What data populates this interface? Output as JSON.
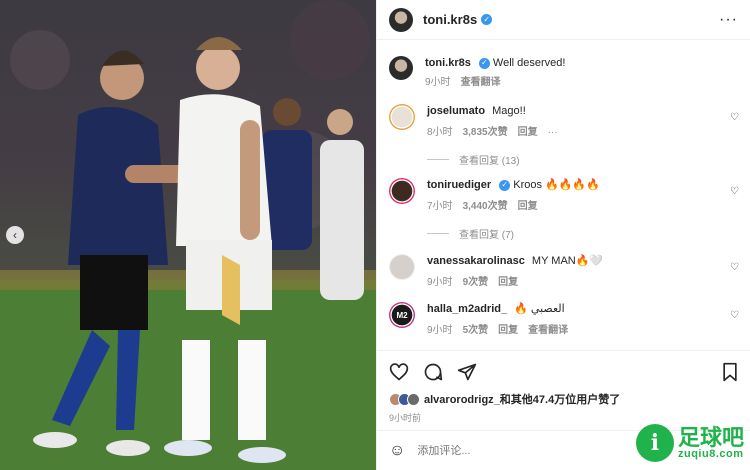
{
  "post": {
    "author": "toni.kr8s",
    "caption": "Well deserved!",
    "caption_time": "9小时",
    "translate_label": "查看翻译"
  },
  "comments": [
    {
      "user": "joselumato",
      "text": "Mago!!",
      "time": "8小时",
      "likes": "3,835次赞",
      "reply": "回复",
      "replies": "查看回复 (13)",
      "more": "···"
    },
    {
      "user": "toniruediger",
      "text": "Kroos 🔥🔥🔥🔥",
      "time": "7小时",
      "likes": "3,440次赞",
      "reply": "回复",
      "replies": "查看回复 (7)"
    },
    {
      "user": "vanessakarolinasc",
      "text": "MY MAN🔥🤍",
      "time": "9小时",
      "likes": "9次赞",
      "reply": "回复"
    },
    {
      "user": "halla_m2adrid_",
      "text": "🔥 العصبي",
      "time": "9小时",
      "likes": "5次赞",
      "reply": "回复",
      "translate": "查看翻译",
      "avatar_text": "M2"
    }
  ],
  "likes_line": {
    "user": "alvarorodrigz",
    "rest": "_和其他47.4万位用户赞了"
  },
  "posted_time": "9小时前",
  "add_comment_placeholder": "添加评论...",
  "watermark": {
    "name": "足球吧",
    "url": "zuqiu8.com",
    "logo_glyph": "i"
  },
  "icons": [
    "more-icon",
    "heart-icon",
    "comment-icon",
    "share-icon",
    "save-icon",
    "emoji-icon",
    "prev-icon"
  ],
  "colors": {
    "verified": "#3897f0",
    "watermark": "#21b34b",
    "muted": "#8e8e8e"
  }
}
